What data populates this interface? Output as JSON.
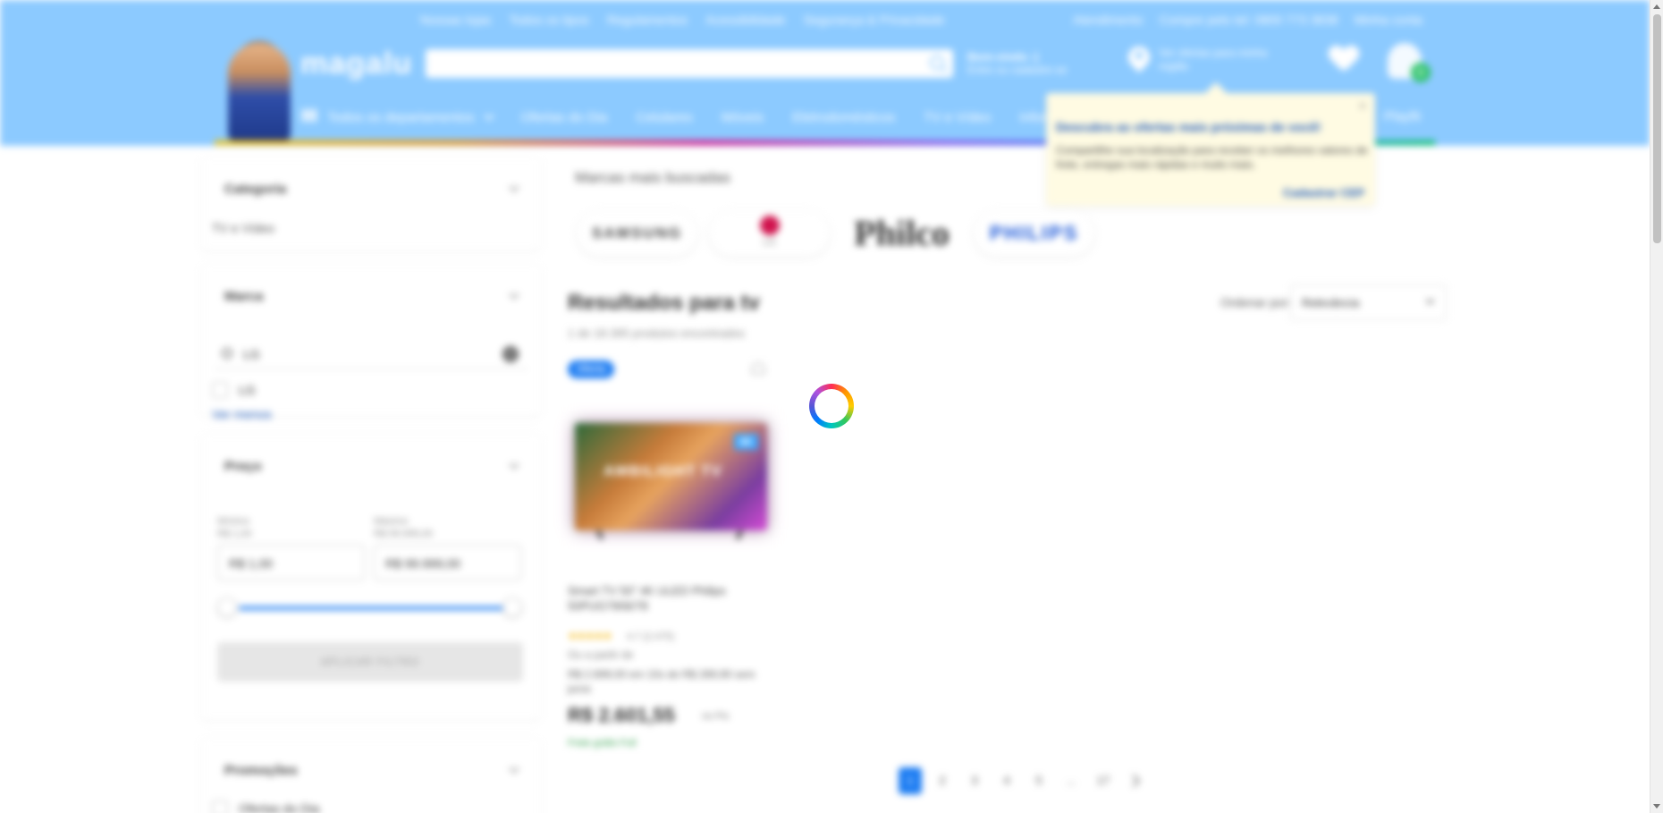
{
  "colors": {
    "header_bg": "#8ccaff",
    "accent_blue": "#1a7bf2",
    "link_blue": "#1a57b8",
    "cart_badge": "#2dc36a"
  },
  "top_links": [
    "Nossas lojas",
    "Todos os tipos",
    "Regulamentos",
    "Acessibilidade",
    "Segurança & Privacidade"
  ],
  "top_links_right": [
    "Atendimento",
    "Compre pelo tel: 0800 773 3838",
    "Minha conta"
  ],
  "header": {
    "logo": "magalu",
    "search_placeholder": "",
    "greeting_line1": "Bem-vindo :)",
    "greeting_line2": "Entre ou cadastre-se",
    "location_line1": "Ver ofertas para minha",
    "location_line2": "região",
    "cart_count": "0",
    "icons": {
      "search": "search-icon",
      "location": "pin-icon",
      "favorites": "heart-icon",
      "cart": "bag-icon"
    }
  },
  "nav": {
    "all_departments": "Todos os departamentos",
    "items": [
      "Ofertas do Dia",
      "Celulares",
      "Móveis",
      "Eletrodomésticos",
      "TV e Vídeo",
      "Informática"
    ],
    "right_item": "Playfit"
  },
  "tooltip": {
    "title": "Descubra as ofertas mais próximas de você!",
    "text": "Compartilhe sua localização para receber os melhores valores de frete, entregas mais rápidas e muito mais.",
    "link": "Cadastrar CEP",
    "close": "×"
  },
  "sidebar": {
    "category": {
      "title": "Categoria",
      "value": "TV e Vídeo"
    },
    "brand": {
      "title": "Marca",
      "search_value": "LG",
      "clear": "×",
      "option": "LG",
      "see_more": "Ver menos"
    },
    "price": {
      "title": "Preço",
      "min_label_1": "Mínimo",
      "min_label_2": "R$ 1,00",
      "max_label_1": "Máximo",
      "max_label_2": "R$ 99.999,00",
      "min_value": "R$ 1,00",
      "max_value": "R$ 99.999,00",
      "apply": "APLICAR FILTRO"
    },
    "promotions": {
      "title": "Promoções",
      "option": "Ofertas do Dia"
    }
  },
  "main": {
    "brands_title": "Marcas mais buscadas",
    "brands": [
      "SAMSUNG",
      "LG",
      "Philco",
      "PHILIPS"
    ],
    "results_title": "Resultados para tv",
    "results_count": "1 de 18.395 produtos encontrados",
    "sort_label": "Ordenar por:",
    "sort_value": "Relevância"
  },
  "product": {
    "tag": "Oferta",
    "tv_text": "AMBILIGHT TV",
    "tv_badge": "4K",
    "name": "Smart TV 50” 4K ULED Philips 50PUG7906/78",
    "stars": "★★★★★",
    "rating": "4.7 (2.475)",
    "old_price": "Ou a partir de",
    "installments": "R$ 2.899,00 em 10x de R$ 289,90 sem juros",
    "price": "R$ 2.601,55",
    "pix": "no Pix",
    "shipping": "Frete grátis Full"
  },
  "pagination": {
    "pages": [
      "1",
      "2",
      "3",
      "4",
      "5",
      "...",
      "17"
    ],
    "active": "1"
  }
}
